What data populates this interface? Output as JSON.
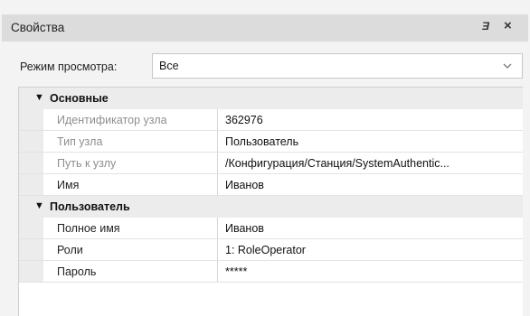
{
  "window": {
    "title": "Свойства",
    "float_icon_glyph": "Ǝ",
    "close_icon_glyph": "×"
  },
  "view_mode": {
    "label": "Режим просмотра:",
    "selected": "Все"
  },
  "categories": [
    {
      "label": "Основные",
      "expand_glyph": "▼",
      "rows": [
        {
          "name": "Идентификатор узла",
          "value": "362976",
          "readonly": true
        },
        {
          "name": "Тип узла",
          "value": "Пользователь",
          "readonly": true
        },
        {
          "name": "Путь к узлу",
          "value": "/Конфигурация/Станция/SystemAuthentic...",
          "readonly": true
        },
        {
          "name": "Имя",
          "value": "Иванов",
          "readonly": false
        }
      ]
    },
    {
      "label": "Пользователь",
      "expand_glyph": "▼",
      "rows": [
        {
          "name": "Полное имя",
          "value": "Иванов",
          "readonly": false
        },
        {
          "name": "Роли",
          "value": "1: RoleOperator",
          "readonly": false
        },
        {
          "name": "Пароль",
          "value": "*****",
          "readonly": false
        }
      ]
    }
  ],
  "colors": {
    "titlebar": "#dcdcdc",
    "panel": "#f3f3f3",
    "category_bg": "#ececec",
    "readonly_text": "#8e8e8e"
  }
}
